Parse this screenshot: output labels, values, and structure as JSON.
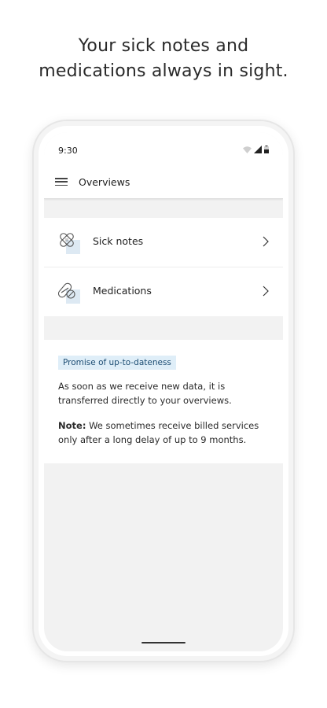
{
  "headline": {
    "line1": "Your sick notes and",
    "line2": "medications always in sight."
  },
  "status_bar": {
    "time": "9:30",
    "icons": [
      "wifi-icon",
      "signal-icon",
      "battery-icon"
    ]
  },
  "app_bar": {
    "menu_icon": "hamburger-menu-icon",
    "title": "Overviews"
  },
  "overview_items": [
    {
      "label": "Sick notes",
      "icon": "bandage-icon"
    },
    {
      "label": "Medications",
      "icon": "pill-icon"
    }
  ],
  "info": {
    "badge": "Promise of up-to-dateness",
    "text": "As soon as we receive new data, it is transferred directly to your overviews.",
    "note_label": "Note:",
    "note_text": " We sometimes receive billed services only after a long delay of up to 9 months."
  },
  "colors": {
    "badge_bg": "#dfeef8",
    "badge_text": "#1d4d73",
    "icon_accent": "#dde9f3",
    "screen_bg": "#f2f2f2"
  }
}
